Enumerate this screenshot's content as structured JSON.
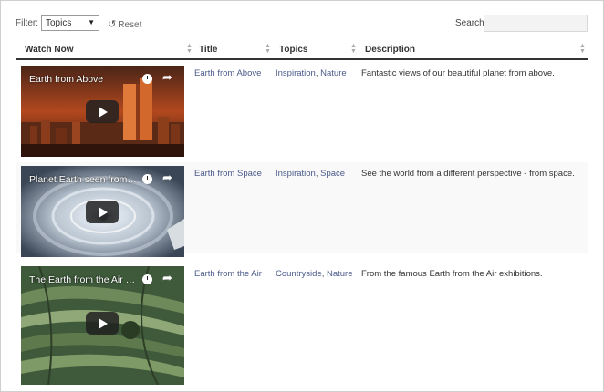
{
  "toolbar": {
    "filter_label": "Filter:",
    "filter_value": "Topics",
    "reset_label": "Reset",
    "search_label": "Search:",
    "search_value": ""
  },
  "table": {
    "columns": [
      "Watch Now",
      "Title",
      "Topics",
      "Description"
    ],
    "rows": [
      {
        "video_title": "Earth from Above",
        "title": "Earth from Above",
        "topics": [
          "Inspiration",
          "Nature"
        ],
        "description": "Fantastic views of our beautiful planet from above."
      },
      {
        "video_title": "Planet Earth seen from ...",
        "title": "Earth from Space",
        "topics": [
          "Inspiration",
          "Space"
        ],
        "description": "See the world from a different perspective - from space."
      },
      {
        "video_title": "The Earth from the Air b...",
        "title": "Earth from the Air",
        "topics": [
          "Countryside",
          "Nature"
        ],
        "description": "From the famous Earth from the Air exhibitions."
      }
    ]
  }
}
